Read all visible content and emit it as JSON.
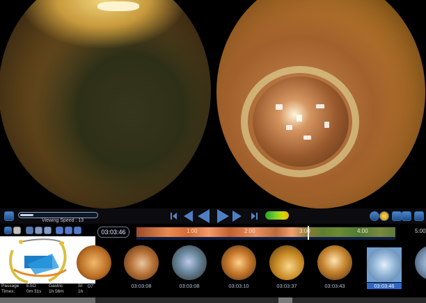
{
  "controls": {
    "viewing_speed": "Viewing Speed : 13",
    "speed_value": 0.17,
    "current_time": "03:03:46",
    "end_time": "5:00"
  },
  "timeline": {
    "ticks": [
      "1:00",
      "2:00",
      "3:00",
      "4:00"
    ]
  },
  "passage": {
    "title_line1": "Passage",
    "title_line2": "Times:",
    "eso_label": "ESO",
    "eso_time": "0m 31s",
    "gastric_label": "Gastric",
    "gastric_time": "1h 56m",
    "sb_label": "SI",
    "sb_time": "1h"
  },
  "thumbnails": [
    {
      "time": "07"
    },
    {
      "time": "03:03:08"
    },
    {
      "time": "03:03:08"
    },
    {
      "time": "03:03:10"
    },
    {
      "time": "03:03:37"
    },
    {
      "time": "03:03:43"
    },
    {
      "time": "03:03:46",
      "selected": true
    }
  ],
  "icons": {
    "back": "undo-icon",
    "prev_frame": "skip-back-icon",
    "rewind": "rewind-icon",
    "play": "play-icon",
    "next_frame": "step-forward-icon",
    "skip_end": "skip-forward-icon",
    "battery": "battery-icon"
  }
}
